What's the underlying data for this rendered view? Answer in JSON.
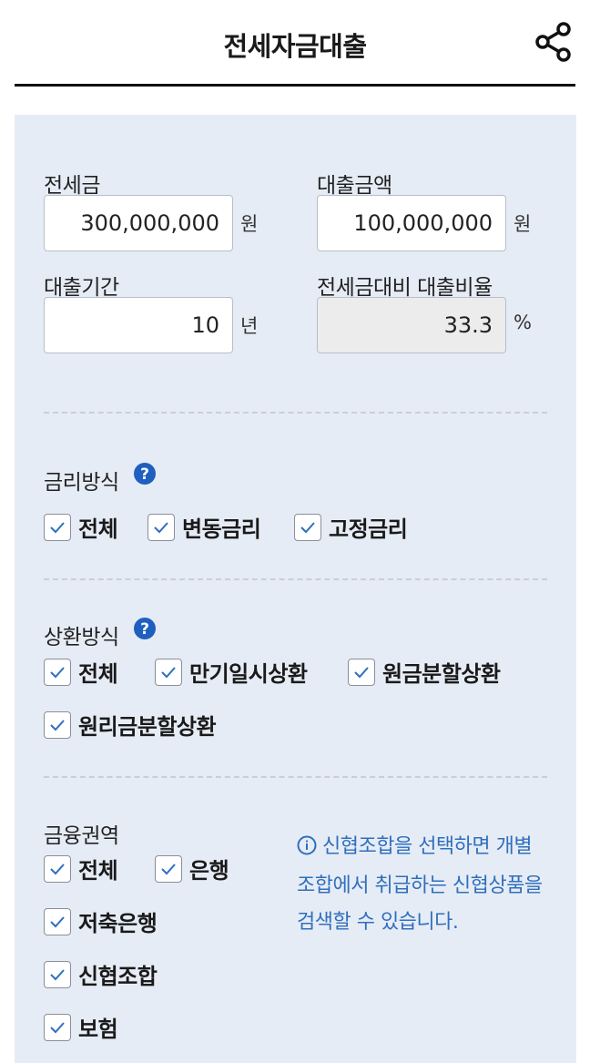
{
  "header": {
    "title": "전세자금대출",
    "share_icon": "share-icon"
  },
  "inputs": {
    "deposit": {
      "label": "전세금",
      "value": "300,000,000",
      "unit": "원"
    },
    "loan_amount": {
      "label": "대출금액",
      "value": "100,000,000",
      "unit": "원"
    },
    "loan_period": {
      "label": "대출기간",
      "value": "10",
      "unit": "년"
    },
    "ratio": {
      "label": "전세금대비 대출비율",
      "value": "33.3",
      "unit": "%"
    }
  },
  "rate_type": {
    "label": "금리방식",
    "options": [
      {
        "label": "전체",
        "checked": true
      },
      {
        "label": "변동금리",
        "checked": true
      },
      {
        "label": "고정금리",
        "checked": true
      }
    ]
  },
  "repayment": {
    "label": "상환방식",
    "options": [
      {
        "label": "전체",
        "checked": true
      },
      {
        "label": "만기일시상환",
        "checked": true
      },
      {
        "label": "원금분할상환",
        "checked": true
      },
      {
        "label": "원리금분할상환",
        "checked": true
      }
    ]
  },
  "sector": {
    "label": "금융권역",
    "options": [
      {
        "label": "전체",
        "checked": true
      },
      {
        "label": "은행",
        "checked": true
      },
      {
        "label": "저축은행",
        "checked": true
      },
      {
        "label": "신협조합",
        "checked": true
      },
      {
        "label": "보험",
        "checked": true
      }
    ],
    "info": "신협조합을 선택하면 개별 조합에서 취급하는 신협상품을 검색할 수 있습니다."
  },
  "colors": {
    "panel": "#e6ecf5",
    "accent": "#2f6fbd",
    "help_icon": "#1f5fbf"
  }
}
